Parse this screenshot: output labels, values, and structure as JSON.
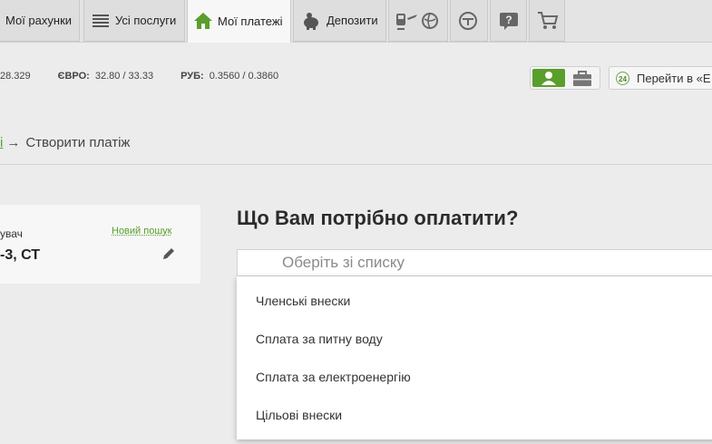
{
  "nav": {
    "tabs": [
      {
        "label": "Мої рахунки",
        "icon": "none"
      },
      {
        "label": "Усі послуги",
        "icon": "list-icon"
      },
      {
        "label": "Мої платежі",
        "icon": "home-icon"
      },
      {
        "label": "Депозити",
        "icon": "piggy-bank-icon"
      }
    ],
    "icon_tabs": [
      "transport-icon",
      "globe-icon",
      "gauge-icon",
      "help-icon",
      "cart-icon"
    ]
  },
  "rates": {
    "first_value": "28.329",
    "eur_label": "ЄВРО:",
    "eur_value": "32.80 / 33.33",
    "rub_label": "РУБ:",
    "rub_value": "0.3560 / 0.3860"
  },
  "account_toggle": {
    "active": "person-icon",
    "inactive": "briefcase-icon",
    "accent": "#5a9e2c"
  },
  "goto": {
    "badge": "24",
    "label": "Перейти в «Е"
  },
  "breadcrumb": {
    "prev": "і",
    "arrow": "→",
    "current": "Створити платіж"
  },
  "recipient_card": {
    "label": "увач",
    "name": "-3, СТ",
    "new_search": "Новий пошук"
  },
  "main": {
    "question": "Що Вам потрібно оплатити?",
    "select_placeholder": "Оберіть зі списку",
    "options": [
      "Членські внески",
      "Сплата за питну воду",
      "Сплата за електроенергію",
      "Цільові внески"
    ]
  }
}
